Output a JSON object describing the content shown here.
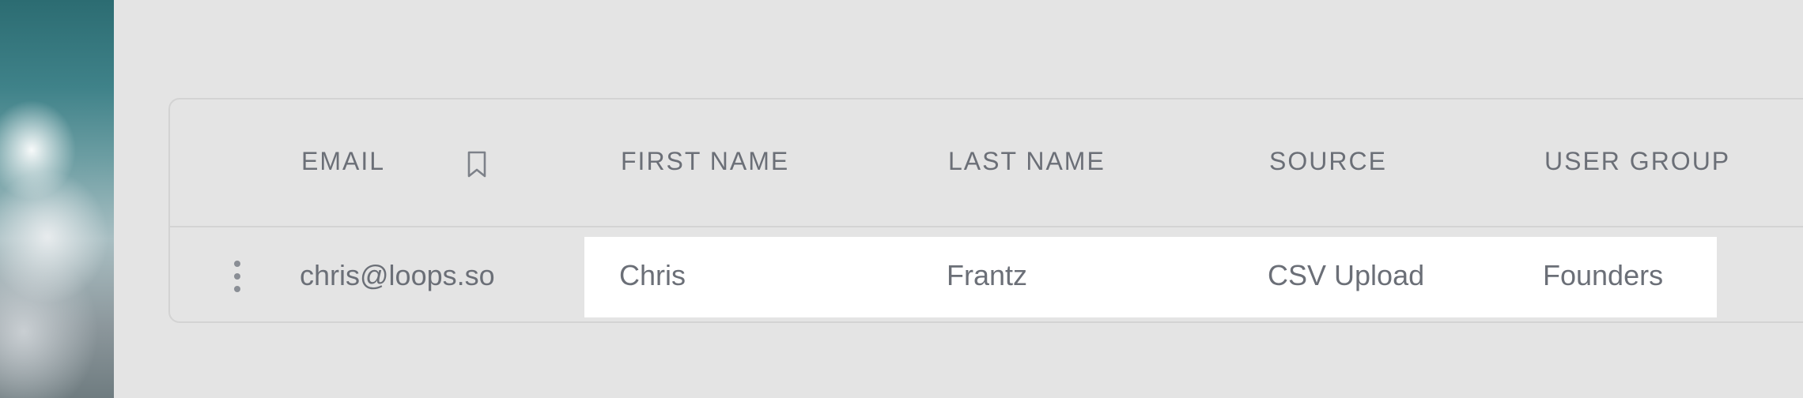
{
  "table": {
    "columns": {
      "email": "EMAIL",
      "first_name": "FIRST NAME",
      "last_name": "LAST NAME",
      "source": "SOURCE",
      "user_group": "USER GROUP"
    },
    "header_icon": "bookmark-icon",
    "rows": [
      {
        "email": "chris@loops.so",
        "first_name": "Chris",
        "last_name": "Frantz",
        "source": "CSV Upload",
        "user_group": "Founders",
        "row_menu_icon": "more-vertical-icon"
      }
    ]
  },
  "colors": {
    "background": "#e4e4e4",
    "border": "#d3d3d3",
    "text": "#6b6f77",
    "row_highlight": "#ffffff"
  }
}
